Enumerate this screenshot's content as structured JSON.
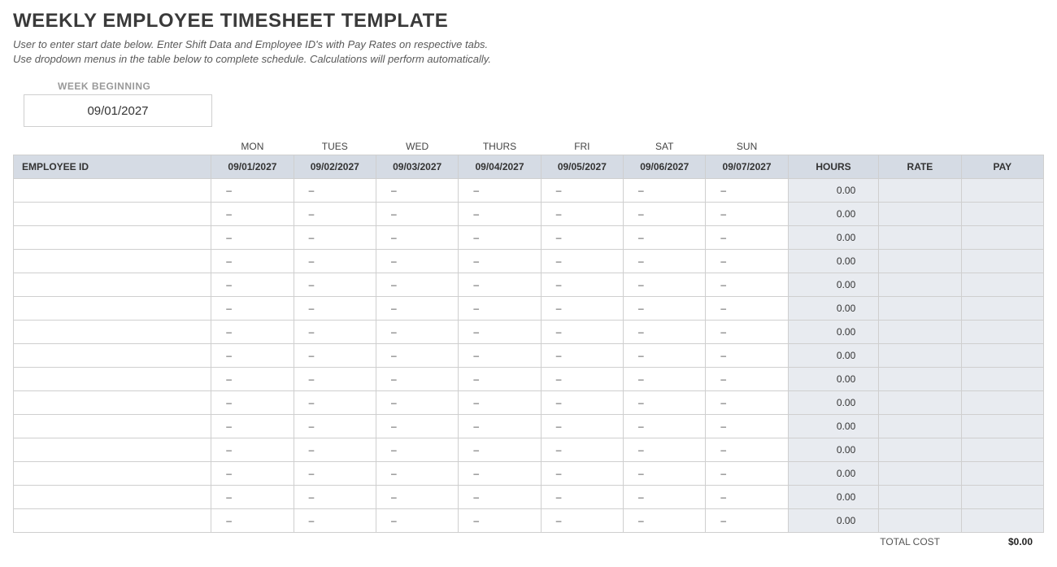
{
  "title": "WEEKLY EMPLOYEE TIMESHEET TEMPLATE",
  "subtitle_line1": "User to enter start date below.  Enter Shift Data and Employee ID's with Pay Rates on respective tabs.",
  "subtitle_line2": "Use dropdown menus in the table below to complete schedule. Calculations will perform automatically.",
  "week_begin_label": "WEEK BEGINNING",
  "week_begin_value": "09/01/2027",
  "columns": {
    "employee_id": "EMPLOYEE ID",
    "days": [
      "MON",
      "TUES",
      "WED",
      "THURS",
      "FRI",
      "SAT",
      "SUN"
    ],
    "dates": [
      "09/01/2027",
      "09/02/2027",
      "09/03/2027",
      "09/04/2027",
      "09/05/2027",
      "09/06/2027",
      "09/07/2027"
    ],
    "hours": "HOURS",
    "rate": "RATE",
    "pay": "PAY"
  },
  "placeholder_dash": "–",
  "rows": [
    {
      "employee": "",
      "hours": "0.00",
      "rate": "",
      "pay": ""
    },
    {
      "employee": "",
      "hours": "0.00",
      "rate": "",
      "pay": ""
    },
    {
      "employee": "",
      "hours": "0.00",
      "rate": "",
      "pay": ""
    },
    {
      "employee": "",
      "hours": "0.00",
      "rate": "",
      "pay": ""
    },
    {
      "employee": "",
      "hours": "0.00",
      "rate": "",
      "pay": ""
    },
    {
      "employee": "",
      "hours": "0.00",
      "rate": "",
      "pay": ""
    },
    {
      "employee": "",
      "hours": "0.00",
      "rate": "",
      "pay": ""
    },
    {
      "employee": "",
      "hours": "0.00",
      "rate": "",
      "pay": ""
    },
    {
      "employee": "",
      "hours": "0.00",
      "rate": "",
      "pay": ""
    },
    {
      "employee": "",
      "hours": "0.00",
      "rate": "",
      "pay": ""
    },
    {
      "employee": "",
      "hours": "0.00",
      "rate": "",
      "pay": ""
    },
    {
      "employee": "",
      "hours": "0.00",
      "rate": "",
      "pay": ""
    },
    {
      "employee": "",
      "hours": "0.00",
      "rate": "",
      "pay": ""
    },
    {
      "employee": "",
      "hours": "0.00",
      "rate": "",
      "pay": ""
    },
    {
      "employee": "",
      "hours": "0.00",
      "rate": "",
      "pay": ""
    }
  ],
  "footer": {
    "total_label": "TOTAL COST",
    "total_value": "$0.00"
  }
}
